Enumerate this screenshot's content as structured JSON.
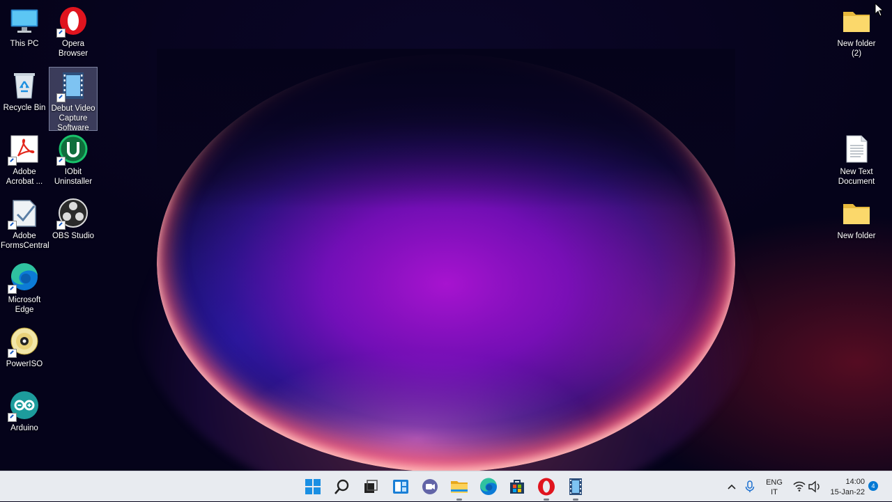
{
  "desktop": {
    "icons_left": [
      {
        "label": "This PC",
        "icon": "monitor-icon"
      },
      {
        "label": "Opera Browser",
        "icon": "opera-icon",
        "shortcut": true
      },
      {
        "label": "Recycle Bin",
        "icon": "recycle-bin-icon"
      },
      {
        "label": "Debut Video Capture Software",
        "icon": "film-strip-icon",
        "shortcut": true,
        "selected": true
      },
      {
        "label": "Adobe Acrobat ...",
        "icon": "acrobat-icon",
        "shortcut": true
      },
      {
        "label": "IObit Uninstaller",
        "icon": "iobit-uninstaller-icon",
        "shortcut": true
      },
      {
        "label": "Adobe FormsCentral",
        "icon": "forms-central-icon",
        "shortcut": true
      },
      {
        "label": "OBS Studio",
        "icon": "obs-icon",
        "shortcut": true
      },
      {
        "label": "Microsoft Edge",
        "icon": "edge-icon",
        "shortcut": true
      },
      {
        "label": "PowerISO",
        "icon": "disc-icon",
        "shortcut": true
      },
      {
        "label": "Arduino",
        "icon": "arduino-icon",
        "shortcut": true
      }
    ],
    "icons_right": [
      {
        "label": "New folder (2)",
        "icon": "folder-icon"
      },
      {
        "label": "New Text Document",
        "icon": "text-document-icon"
      },
      {
        "label": "New folder",
        "icon": "folder-icon"
      }
    ]
  },
  "taskbar": {
    "pinned": [
      "start-icon",
      "search-icon",
      "task-view-icon",
      "widgets-icon",
      "teams-chat-icon",
      "file-explorer-icon",
      "edge-icon",
      "store-icon",
      "opera-icon",
      "debut-icon"
    ],
    "tray": {
      "language_top": "ENG",
      "language_bottom": "IT",
      "time": "14:00",
      "date": "15-Jan-22",
      "notification_count": "4"
    }
  },
  "colors": {
    "taskbar_bg": "#e8ebf0",
    "accent_blue": "#0078d4",
    "opera_red": "#e0141e"
  }
}
